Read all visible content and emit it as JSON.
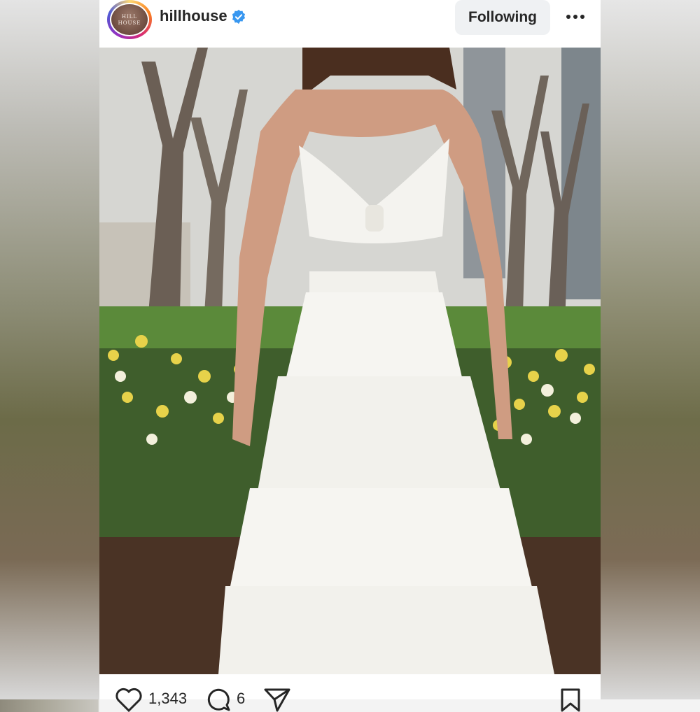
{
  "post": {
    "username": "hillhouse",
    "avatar_text": "HILL HOUSE",
    "follow_label": "Following",
    "likes": "1,343",
    "comments": "6"
  },
  "icons": {
    "verified": "verified-badge-icon",
    "more": "more-options-icon",
    "like": "heart-icon",
    "comment": "comment-icon",
    "share": "share-icon",
    "save": "bookmark-icon"
  },
  "colors": {
    "verified": "#3897f0",
    "button_bg": "#eff1f3",
    "text": "#262626"
  }
}
